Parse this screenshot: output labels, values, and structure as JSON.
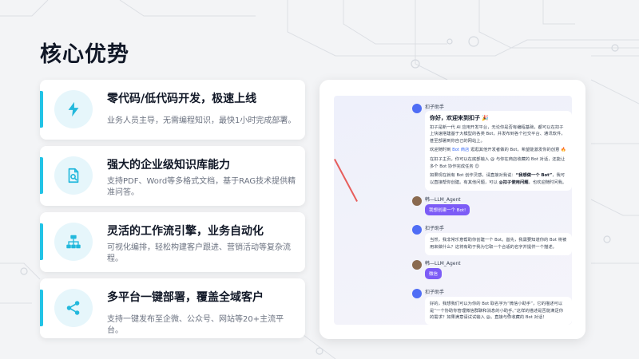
{
  "slide": {
    "title": "核心优势"
  },
  "cards": [
    {
      "title": "零代码/低代码开发，极速上线",
      "desc": "业务人员主导，无需编程知识，最快1小时完成部署。",
      "icon": "lightning-icon"
    },
    {
      "title": "强大的企业级知识库能力",
      "desc": "支持PDF、Word等多格式文档，基于RAG技术提供精准问答。",
      "icon": "document-search-icon"
    },
    {
      "title": "灵活的工作流引擎，业务自动化",
      "desc": "可视化编排，轻松构建客户跟进、营销活动等复杂流程。",
      "icon": "workflow-icon"
    },
    {
      "title": "多平台一键部署，覆盖全域客户",
      "desc": "支持一键发布至企微、公众号、网站等20+主流平台。",
      "icon": "share-icon"
    }
  ],
  "chat": {
    "bot_name": "扣子助手",
    "user_name": "韩—LLM_Agent",
    "welcome_title": "你好，欢迎来到扣子 🎉",
    "welcome_p1": "扣子是新一代 AI 应用开发平台，无论你是否有编程基础，都可以在扣子上快速搭建基于大模型的各类 Bot，并发布到各个社交平台、通讯软件，甚至部署到你自己的网站上。",
    "welcome_p2_pre": "欢迎随时到 ",
    "welcome_p2_link": "Bot 商店",
    "welcome_p2_post": " 逛逛其他开发者做的 Bot，希望能激发你的创意 🔥",
    "welcome_p3": "在扣子主页，你可以在底部输入 @ 与你在商店收藏的 Bot 对话，还能让多个 Bot 协作完成任务 😊",
    "welcome_p4_pre": "如果现在就有 Bot 创作灵感，请直接对我说：",
    "welcome_p4_strong": "“我想做一个 Bot”",
    "welcome_p4_mid": "，我可以直接帮你创建。",
    "welcome_p4_post_pre": "有其他问题，可以 ",
    "welcome_p4_post_strong": "@扣子使用问题",
    "welcome_p4_post_end": "，也欢迎随时问我。",
    "user_msg1": "我想创建一个 Bot!",
    "reply1": "当然，我非常乐意帮助你创建一个 Bot。首先，我需要知道你的 Bot 将被用来做什么？这将有助于我为它取一个合适的名字并提供一个描述。",
    "user_msg2": "微信",
    "reply2": "好的，我想我们可以为你的 Bot 取名字为“微信小助手”，它的描述可以是“一个协助你管理微信群聊和消息的小助手。”这样的描述是否能满足你的需求？如果满意请试试输入 @。直接与你收藏的 Bot 对话！",
    "close_glyph": "✕"
  }
}
